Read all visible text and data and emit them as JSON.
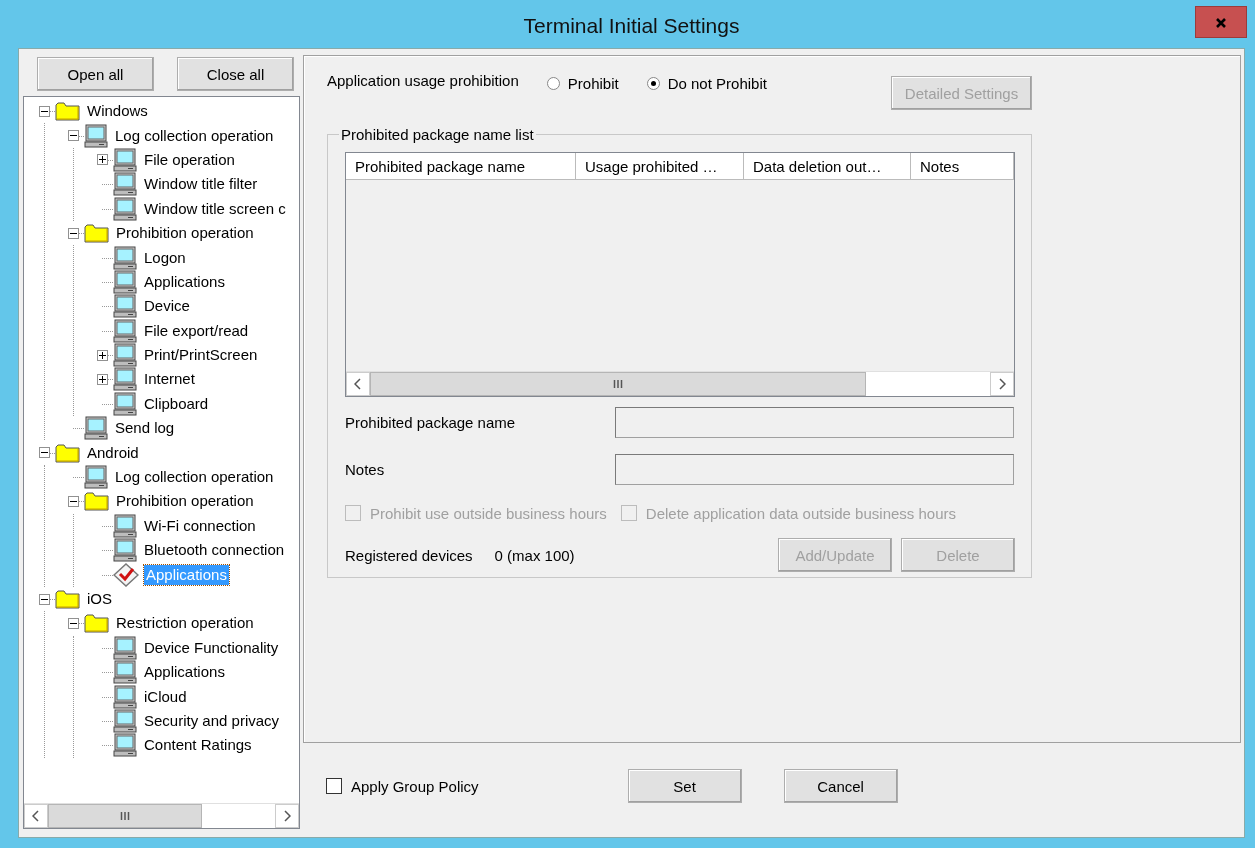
{
  "window": {
    "title": "Terminal Initial Settings"
  },
  "tree_buttons": [
    "Open all",
    "Close all"
  ],
  "tree": [
    {
      "label": "Windows",
      "kind": "folder",
      "expanded": true,
      "selected": false,
      "children": [
        {
          "label": "Log collection operation",
          "kind": "computer",
          "expanded": true,
          "selected": false,
          "children": [
            {
              "label": "File operation",
              "kind": "computer",
              "expanded": false,
              "selected": false
            },
            {
              "label": "Window title filter",
              "kind": "computer",
              "selected": false
            },
            {
              "label": "Window title screen c",
              "kind": "computer",
              "selected": false
            }
          ]
        },
        {
          "label": "Prohibition operation",
          "kind": "folder",
          "expanded": true,
          "selected": false,
          "children": [
            {
              "label": "Logon",
              "kind": "computer",
              "selected": false
            },
            {
              "label": "Applications",
              "kind": "computer",
              "selected": false
            },
            {
              "label": "Device",
              "kind": "computer",
              "selected": false
            },
            {
              "label": "File export/read",
              "kind": "computer",
              "selected": false
            },
            {
              "label": "Print/PrintScreen",
              "kind": "computer",
              "expanded": false,
              "selected": false
            },
            {
              "label": "Internet",
              "kind": "computer",
              "expanded": false,
              "selected": false
            },
            {
              "label": "Clipboard",
              "kind": "computer",
              "selected": false
            }
          ]
        },
        {
          "label": "Send log",
          "kind": "computer",
          "selected": false
        }
      ]
    },
    {
      "label": "Android",
      "kind": "folder",
      "expanded": true,
      "selected": false,
      "children": [
        {
          "label": "Log collection operation",
          "kind": "computer",
          "selected": false
        },
        {
          "label": "Prohibition operation",
          "kind": "folder",
          "expanded": true,
          "selected": false,
          "children": [
            {
              "label": "Wi-Fi connection",
              "kind": "computer",
              "selected": false
            },
            {
              "label": "Bluetooth connection",
              "kind": "computer",
              "selected": false
            },
            {
              "label": "Applications",
              "kind": "check",
              "selected": true
            }
          ]
        }
      ]
    },
    {
      "label": "iOS",
      "kind": "folder",
      "expanded": true,
      "selected": false,
      "children": [
        {
          "label": "Restriction operation",
          "kind": "folder",
          "expanded": true,
          "selected": false,
          "children": [
            {
              "label": "Device Functionality",
              "kind": "computer",
              "selected": false
            },
            {
              "label": "Applications",
              "kind": "computer",
              "selected": false
            },
            {
              "label": "iCloud",
              "kind": "computer",
              "selected": false
            },
            {
              "label": "Security and privacy",
              "kind": "computer",
              "selected": false
            },
            {
              "label": "Content Ratings",
              "kind": "computer",
              "selected": false
            }
          ]
        }
      ]
    }
  ],
  "usage": {
    "label": "Application usage prohibition",
    "options": [
      {
        "label": "Prohibit",
        "selected": false
      },
      {
        "label": "Do not Prohibit",
        "selected": true
      }
    ]
  },
  "detail_button": {
    "label": "Detailed Settings",
    "disabled": true
  },
  "group": {
    "title": "Prohibited package name list",
    "columns": [
      "Prohibited package name",
      "Usage prohibited …",
      "Data deletion out…",
      "Notes"
    ],
    "fields": [
      {
        "label": "Prohibited package name"
      },
      {
        "label": "Notes"
      }
    ],
    "checkboxes": [
      {
        "label": "Prohibit use outside business hours",
        "checked": false,
        "disabled": true
      },
      {
        "label": "Delete application data outside business hours",
        "checked": false,
        "disabled": true
      }
    ],
    "registered": {
      "label": "Registered devices",
      "value": "0 (max 100)"
    },
    "buttons": [
      {
        "label": "Add/Update",
        "disabled": true
      },
      {
        "label": "Delete",
        "disabled": true
      }
    ]
  },
  "footer": {
    "apply": {
      "label": "Apply Group Policy",
      "checked": false
    },
    "buttons": [
      "Set",
      "Cancel"
    ]
  }
}
